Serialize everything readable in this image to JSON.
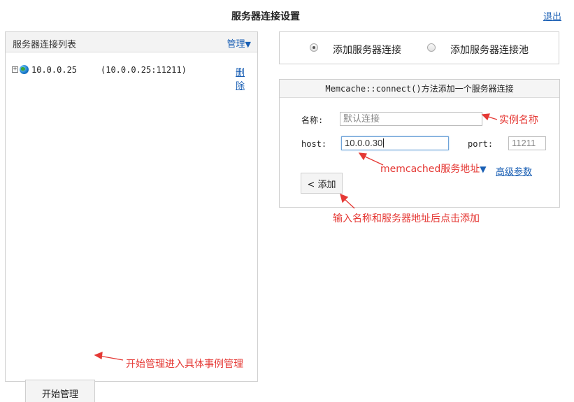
{
  "header": {
    "title": "服务器连接设置",
    "logout_label": "退出"
  },
  "left_panel": {
    "title": "服务器连接列表",
    "manage_label": "管理",
    "manage_arrow": "▼",
    "servers": [
      {
        "expand": "+",
        "ip": "10.0.0.25",
        "endpoint": "(10.0.0.25:11211)",
        "delete_label": "删除"
      }
    ],
    "start_button_label": "开始管理"
  },
  "mode": {
    "options": [
      {
        "label": "添加服务器连接",
        "checked": true
      },
      {
        "label": "添加服务器连接池",
        "checked": false
      }
    ]
  },
  "form": {
    "header": "Memcache::connect()方法添加一个服务器连接",
    "name_label": "名称:",
    "name_placeholder": "默认连接",
    "host_label": "host:",
    "host_value": "10.0.0.30",
    "port_label": "port:",
    "port_placeholder": "11211",
    "advanced_label": "高级参数",
    "add_button_label": "< 添加"
  },
  "annotations": {
    "instance_name": "实例名称",
    "server_address": "memcached服务地址",
    "server_address_arrow": "▼",
    "add_hint": "输入名称和服务器地址后点击添加",
    "start_hint": "开始管理进入具体事例管理"
  },
  "colors": {
    "link": "#1a5fb4",
    "annotation": "#e53935",
    "panel_border": "#cfcfcf",
    "header_bg": "#f3f3f3"
  }
}
